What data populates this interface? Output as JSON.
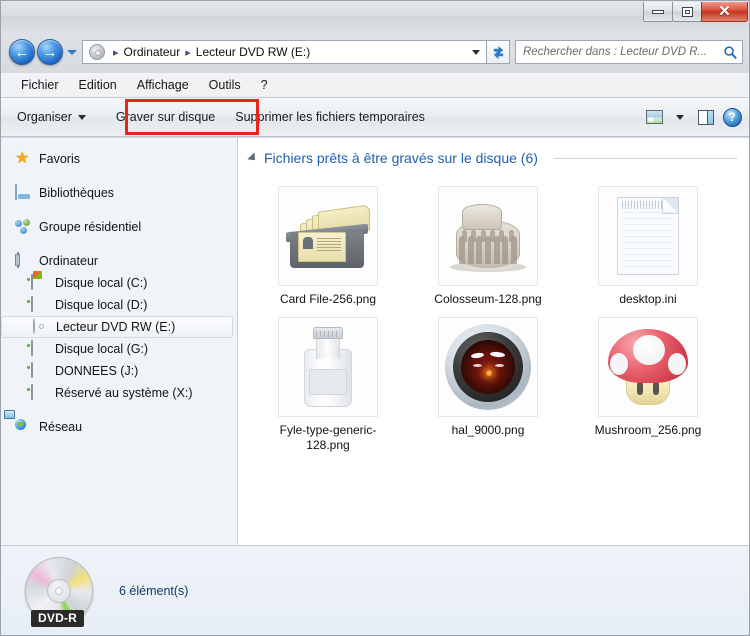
{
  "window": {
    "controls": {
      "minimize_label": "–",
      "maximize_label": "□",
      "close_label": "✕"
    }
  },
  "navigation": {
    "back_label": "←",
    "forward_label": "→",
    "recent_pages_label": "▼",
    "refresh_label": "↻",
    "breadcrumb": {
      "separator": "▸",
      "items": [
        "Ordinateur",
        "Lecteur DVD RW (E:)"
      ],
      "dropdown_label": "▼"
    }
  },
  "search": {
    "placeholder": "Rechercher dans : Lecteur DVD R...",
    "value": "",
    "icon_label": "⌕"
  },
  "menubar": {
    "items": [
      {
        "label": "Fichier"
      },
      {
        "label": "Edition"
      },
      {
        "label": "Affichage"
      },
      {
        "label": "Outils"
      },
      {
        "label": "?"
      }
    ]
  },
  "toolbar": {
    "organize_label": "Organiser",
    "burn_label": "Graver sur disque",
    "delete_temp_label": "Supprimer les fichiers temporaires",
    "views_label": "",
    "views_caret_label": "",
    "preview_pane_label": "",
    "help_label": "?"
  },
  "sidebar": {
    "items": [
      {
        "label": "Favoris",
        "icon": "star-icon",
        "level": 0
      },
      {
        "label": "Bibliothèques",
        "icon": "libraries-icon",
        "level": 0
      },
      {
        "label": "Groupe résidentiel",
        "icon": "homegroup-icon",
        "level": 0
      },
      {
        "label": "Ordinateur",
        "icon": "computer-icon",
        "level": 0
      },
      {
        "label": "Disque local (C:)",
        "icon": "system-drive-icon",
        "level": 1
      },
      {
        "label": "Disque local (D:)",
        "icon": "drive-icon",
        "level": 1
      },
      {
        "label": "Lecteur DVD RW (E:)",
        "icon": "dvd-drive-icon",
        "level": 1,
        "selected": true
      },
      {
        "label": "Disque local (G:)",
        "icon": "drive-icon",
        "level": 1
      },
      {
        "label": "DONNEES (J:)",
        "icon": "drive-icon",
        "level": 1
      },
      {
        "label": "Réservé au système (X:)",
        "icon": "drive-icon",
        "level": 1
      },
      {
        "label": "Réseau",
        "icon": "network-icon",
        "level": 0
      }
    ]
  },
  "filepane": {
    "group_title": "Fichiers prêts à être gravés sur le disque (6)",
    "files": [
      {
        "name": "Card File-256.png",
        "art": "cardfile"
      },
      {
        "name": "Colosseum-128.png",
        "art": "colosseum"
      },
      {
        "name": "desktop.ini",
        "art": "ini"
      },
      {
        "name": "Fyle-type-generic-128.png",
        "art": "bottle"
      },
      {
        "name": "hal_9000.png",
        "art": "hal"
      },
      {
        "name": "Mushroom_256.png",
        "art": "mushroom"
      }
    ]
  },
  "statusbar": {
    "disc_badge": "DVD-R",
    "item_count_text": "6 élément(s)"
  },
  "colors": {
    "accent_blue": "#1f5fb0",
    "highlight_red": "#e8251c",
    "close_red": "#c33520",
    "status_text": "#103a6b"
  }
}
